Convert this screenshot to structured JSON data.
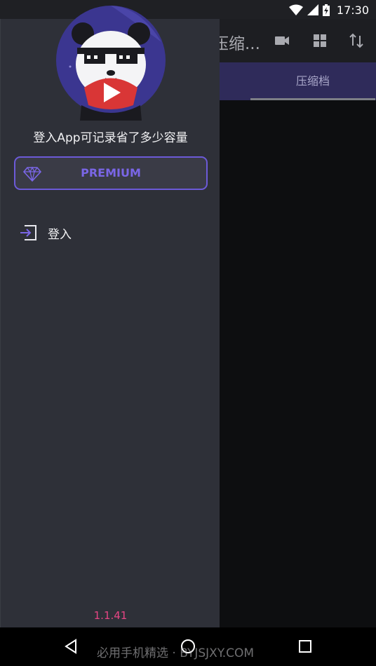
{
  "status_bar": {
    "time": "17:30",
    "icons": [
      "wifi-icon",
      "cellular-signal-icon",
      "battery-charging-icon"
    ]
  },
  "app": {
    "title": "压缩...",
    "toolbar_icons": [
      "video-camera-icon",
      "grid-view-icon",
      "sort-icon"
    ],
    "tabs": [
      {
        "label": "压缩档",
        "selected": true
      }
    ],
    "tab_color": "#2f2b5a"
  },
  "drawer": {
    "login_prompt": "登入App可记录省了多少容量",
    "premium_label": "PREMIUM",
    "menu_items": [
      {
        "label": "登入",
        "icon": "login-icon"
      }
    ],
    "version": "1.1.41",
    "accent_color": "#6c5ad8",
    "version_color": "#e64584"
  },
  "nav_bar": {
    "buttons": [
      "back-icon",
      "home-icon",
      "recents-icon"
    ],
    "watermark": "必用手机精选 · BYJSJXY.COM"
  }
}
